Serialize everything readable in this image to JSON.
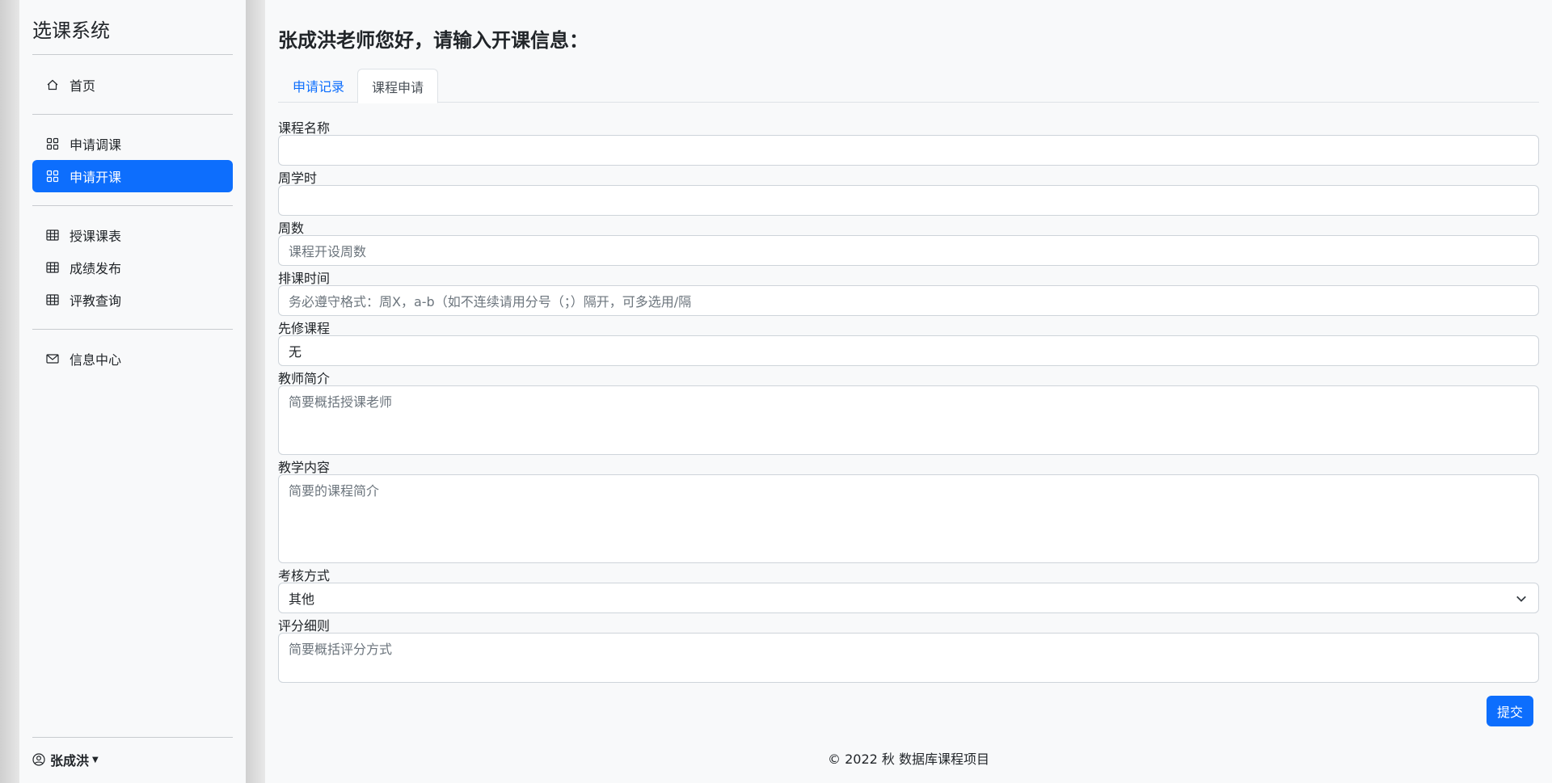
{
  "sidebar": {
    "brand": "选课系统",
    "items": [
      {
        "label": "首页",
        "icon": "house-icon"
      },
      {
        "label": "申请调课",
        "icon": "grid-icon"
      },
      {
        "label": "申请开课",
        "icon": "grid-icon",
        "active": true
      },
      {
        "label": "授课课表",
        "icon": "table-icon"
      },
      {
        "label": "成绩发布",
        "icon": "table-icon"
      },
      {
        "label": "评教查询",
        "icon": "table-icon"
      },
      {
        "label": "信息中心",
        "icon": "envelope-icon"
      }
    ],
    "user": "张成洪"
  },
  "main": {
    "title": "张成洪老师您好，请输入开课信息：",
    "tabs": [
      {
        "label": "申请记录",
        "active": false
      },
      {
        "label": "课程申请",
        "active": true
      }
    ],
    "form": {
      "course_name": {
        "label": "课程名称",
        "value": "",
        "placeholder": ""
      },
      "weekly_hours": {
        "label": "周学时",
        "value": "",
        "placeholder": ""
      },
      "weeks": {
        "label": "周数",
        "placeholder": "课程开设周数"
      },
      "schedule": {
        "label": "排课时间",
        "placeholder": "务必遵守格式：周X，a-b（如不连续请用分号（；）隔开，可多选用/隔"
      },
      "prerequisite": {
        "label": "先修课程",
        "value": "无"
      },
      "teacher_intro": {
        "label": "教师简介",
        "placeholder": "简要概括授课老师"
      },
      "content": {
        "label": "教学内容",
        "placeholder": "简要的课程简介"
      },
      "assessment": {
        "label": "考核方式",
        "selected": "其他"
      },
      "grading": {
        "label": "评分细则",
        "placeholder": "简要概括评分方式"
      }
    },
    "submit_label": "提交"
  },
  "footer": "© 2022 秋 数据库课程项目",
  "colors": {
    "accent": "#0d6efd",
    "background": "#f8f9fa",
    "border": "#ced4da"
  }
}
